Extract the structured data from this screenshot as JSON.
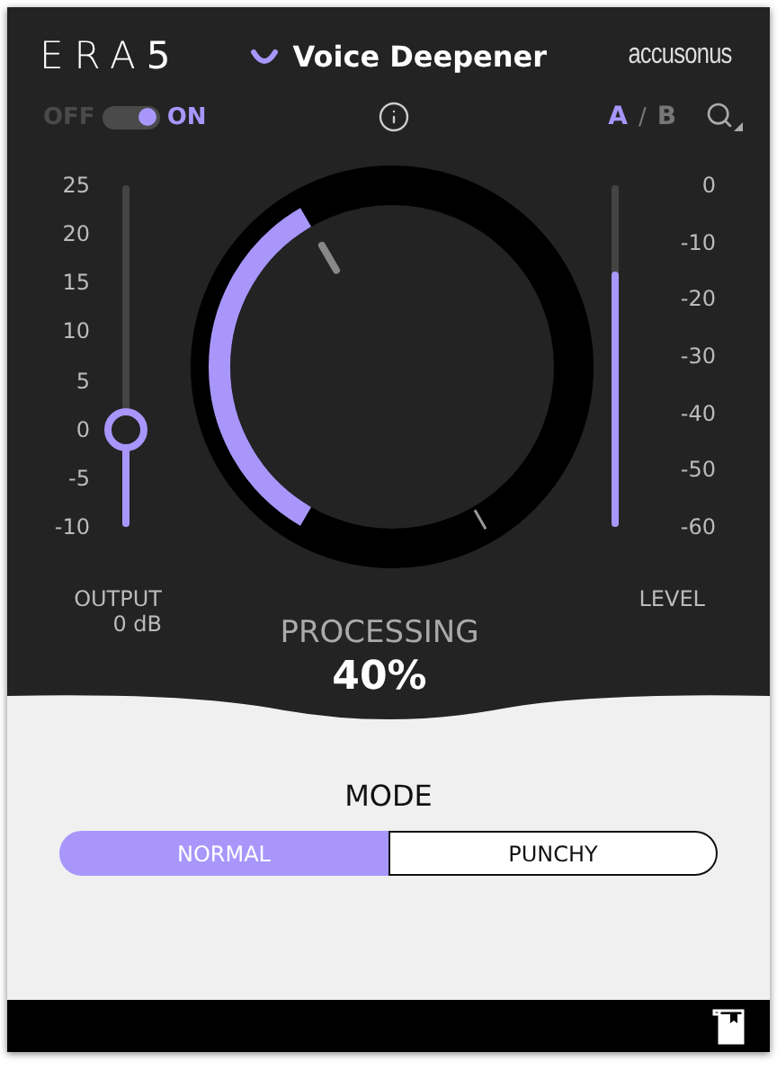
{
  "header": {
    "logo": "ERA**5**",
    "title": "Voice Deepener",
    "brand": "accusonus"
  },
  "power": {
    "off_label": "OFF",
    "on_label": "ON",
    "on": true
  },
  "ab": [
    {
      "label": "A",
      "selected": true
    },
    {
      "label": "B",
      "selected": false
    }
  ],
  "ab_separator": "/",
  "output": {
    "scale": [
      "25",
      "20",
      "15",
      "10",
      "5",
      "0",
      "-5",
      "-10"
    ],
    "level": 0.286,
    "label": "OUTPUT",
    "reading": "0 dB"
  },
  "processing": {
    "label": "PROCESSING",
    "reading": "40%"
  },
  "meter": {
    "scale": [
      "0",
      "-10",
      "-20",
      "-30",
      "-40",
      "-50",
      "-60"
    ],
    "level": 0.75,
    "label": "LEVEL"
  },
  "mode": {
    "label": "MODE",
    "options": [
      {
        "label": "NORMAL",
        "selected": true
      },
      {
        "label": "PUNCHY",
        "selected": false
      }
    ]
  }
}
